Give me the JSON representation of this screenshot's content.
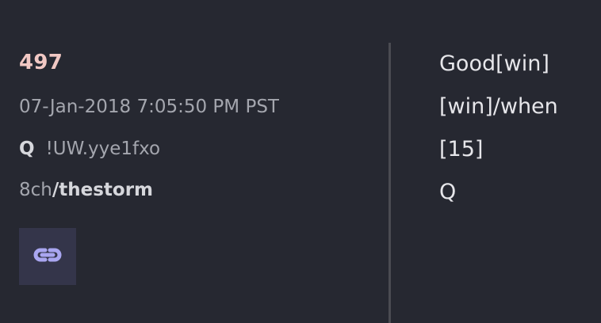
{
  "post": {
    "number": "497",
    "timestamp": "07-Jan-2018 7:05:50 PM PST",
    "author": "Q",
    "tripcode": "!UW.yye1fxo",
    "board_site": "8ch",
    "board_name": "/thestorm"
  },
  "actions": {
    "link_icon": "link-icon"
  },
  "message": {
    "lines": [
      "Good[win]",
      "[win]/when",
      "[15]",
      "Q"
    ]
  },
  "colors": {
    "background": "#262831",
    "post_number": "#f1c8c4",
    "link_icon": "#a9a6f0",
    "link_button_bg": "#34354a"
  }
}
